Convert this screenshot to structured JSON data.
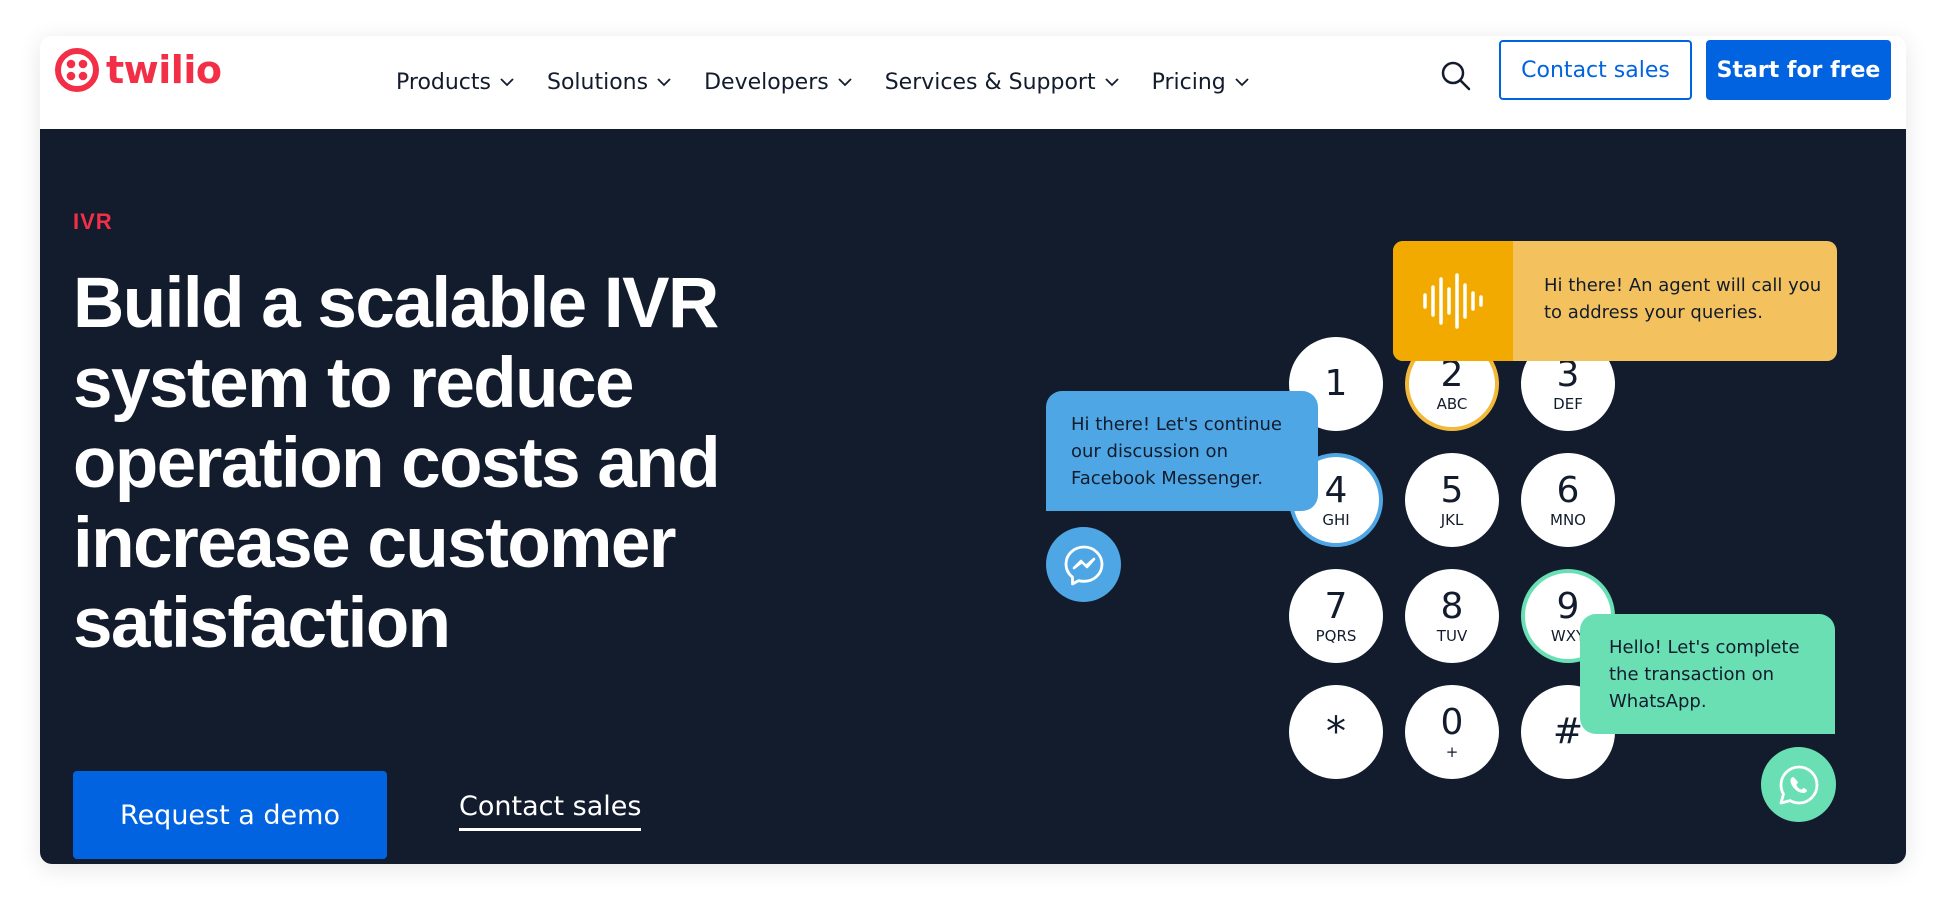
{
  "brand": {
    "name": "twilio",
    "color": "#f22f46"
  },
  "nav": {
    "items": [
      {
        "label": "Products"
      },
      {
        "label": "Solutions"
      },
      {
        "label": "Developers"
      },
      {
        "label": "Services & Support"
      },
      {
        "label": "Pricing"
      }
    ],
    "search_icon": "search-icon",
    "contact_sales_label": "Contact sales",
    "start_free_label": "Start for free"
  },
  "hero": {
    "eyebrow": "IVR",
    "headline": "Build a scalable IVR system to reduce operation costs and increase customer satisfaction",
    "primary_cta": "Request a demo",
    "secondary_cta": "Contact sales"
  },
  "illustration": {
    "keypad": [
      {
        "digit": "1",
        "letters": ""
      },
      {
        "digit": "2",
        "letters": "ABC"
      },
      {
        "digit": "3",
        "letters": "DEF"
      },
      {
        "digit": "4",
        "letters": "GHI"
      },
      {
        "digit": "5",
        "letters": "JKL"
      },
      {
        "digit": "6",
        "letters": "MNO"
      },
      {
        "digit": "7",
        "letters": "PQRS"
      },
      {
        "digit": "8",
        "letters": "TUV"
      },
      {
        "digit": "9",
        "letters": "WXY"
      },
      {
        "digit": "*",
        "letters": ""
      },
      {
        "digit": "0",
        "letters": "+"
      },
      {
        "digit": "#",
        "letters": ""
      }
    ],
    "bubbles": {
      "agent": "Hi there! An agent will call you to address your queries.",
      "messenger": "Hi there! Let's continue our discussion on Facebook Messenger.",
      "whatsapp": "Hello! Let's complete the transaction on WhatsApp."
    },
    "icons": [
      "soundwave-icon",
      "messenger-icon",
      "whatsapp-icon"
    ]
  },
  "colors": {
    "primary": "#0263e0",
    "hero_bg": "#121c2d",
    "accent_red": "#f22f46",
    "bubble_yellow": "#f3c25e",
    "bubble_blue": "#4ea7e4",
    "bubble_green": "#6adfb4"
  }
}
